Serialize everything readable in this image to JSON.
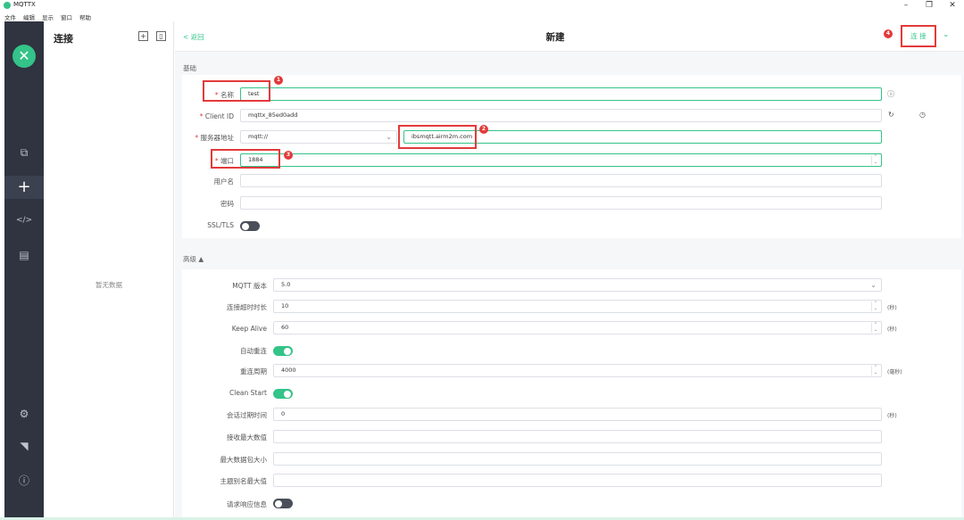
{
  "window": {
    "title": "MQTTX",
    "controls": [
      "–",
      "❐",
      "✕"
    ]
  },
  "menu": [
    "文件",
    "编辑",
    "显示",
    "窗口",
    "帮助"
  ],
  "sidebar": {
    "brand_glyph": "✕",
    "nav_icons": [
      "copy-icon",
      "plus-icon",
      "code-icon",
      "log-icon",
      "settings-icon",
      "feed-icon",
      "info-icon"
    ]
  },
  "connections": {
    "title": "连接",
    "empty_text": "暂无数据"
  },
  "header": {
    "back_label": "< 返回",
    "title": "新建",
    "connect_label": "连 接"
  },
  "basic": {
    "section_label": "基础",
    "name": {
      "label": "名称",
      "value": "test"
    },
    "client_id": {
      "label": "Client ID",
      "value": "mqttx_85ed0add"
    },
    "server": {
      "label": "服务器地址",
      "protocol": "mqtt://",
      "host": "ibsmqtt.airm2m.com"
    },
    "port": {
      "label": "端口",
      "value": "1884"
    },
    "username": {
      "label": "用户名",
      "value": ""
    },
    "password": {
      "label": "密码",
      "value": ""
    },
    "ssl": {
      "label": "SSL/TLS",
      "on": false
    }
  },
  "advanced": {
    "section_label": "高级 ▲",
    "mqtt_version": {
      "label": "MQTT 版本",
      "value": "5.0"
    },
    "connect_timeout": {
      "label": "连接超时时长",
      "value": "10",
      "unit": "(秒)"
    },
    "keep_alive": {
      "label": "Keep Alive",
      "value": "60",
      "unit": "(秒)"
    },
    "auto_reconnect": {
      "label": "自动重连",
      "on": true
    },
    "reconnect_period": {
      "label": "重连周期",
      "value": "4000",
      "unit": "(毫秒)"
    },
    "clean_start": {
      "label": "Clean Start",
      "on": true
    },
    "session_expiry": {
      "label": "会话过期时间",
      "value": "0",
      "unit": "(秒)"
    },
    "receive_max": {
      "label": "接收最大数值",
      "value": ""
    },
    "max_packet": {
      "label": "最大数据包大小",
      "value": ""
    },
    "topic_alias_max": {
      "label": "主题别名最大值",
      "value": ""
    },
    "request_response": {
      "label": "请求响应信息",
      "on": false
    }
  },
  "annotations": [
    "1",
    "2",
    "3",
    "4"
  ],
  "colors": {
    "accent": "#34c388",
    "highlight": "#e33a3a",
    "sidebar": "#2f3440"
  }
}
